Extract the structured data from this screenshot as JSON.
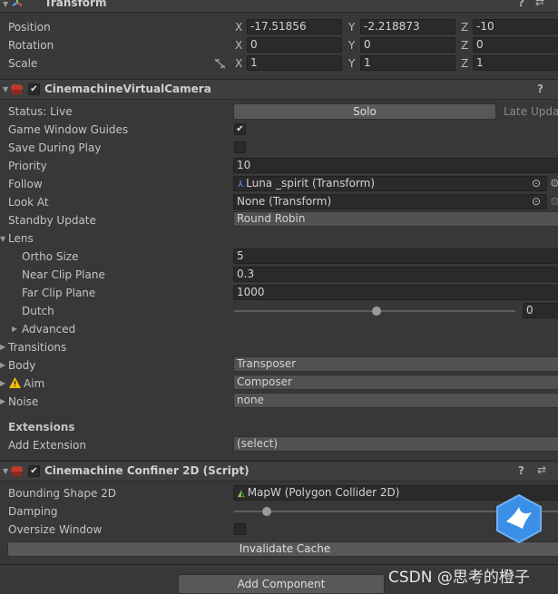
{
  "transform": {
    "title": "Transform",
    "position": {
      "label": "Position",
      "x": "-17.51856",
      "y": "-2.218873",
      "z": "-10"
    },
    "rotation": {
      "label": "Rotation",
      "x": "0",
      "y": "0",
      "z": "0"
    },
    "scale": {
      "label": "Scale",
      "x": "1",
      "y": "1",
      "z": "1"
    },
    "axis_x": "X",
    "axis_y": "Y",
    "axis_z": "Z"
  },
  "vcam": {
    "title": "CinemachineVirtualCamera",
    "status_label": "Status: Live",
    "solo_label": "Solo",
    "late_update": "Late Update",
    "game_window_guides": {
      "label": "Game Window Guides",
      "checked": true
    },
    "save_during_play": {
      "label": "Save During Play",
      "checked": false
    },
    "priority": {
      "label": "Priority",
      "value": "10"
    },
    "follow": {
      "label": "Follow",
      "value": "Luna _spirit (Transform)"
    },
    "look_at": {
      "label": "Look At",
      "value": "None (Transform)"
    },
    "standby_update": {
      "label": "Standby Update",
      "value": "Round Robin"
    },
    "lens": {
      "label": "Lens",
      "ortho_size": {
        "label": "Ortho Size",
        "value": "5"
      },
      "near_clip": {
        "label": "Near Clip Plane",
        "value": "0.3"
      },
      "far_clip": {
        "label": "Far Clip Plane",
        "value": "1000"
      },
      "dutch": {
        "label": "Dutch",
        "value": "0",
        "fraction": 0.5
      },
      "advanced": "Advanced"
    },
    "transitions": "Transitions",
    "body": {
      "label": "Body",
      "value": "Transposer"
    },
    "aim": {
      "label": "Aim",
      "value": "Composer"
    },
    "noise": {
      "label": "Noise",
      "value": "none"
    },
    "extensions_title": "Extensions",
    "add_extension": {
      "label": "Add Extension",
      "value": "(select)"
    }
  },
  "confiner": {
    "title": "Cinemachine Confiner 2D (Script)",
    "bounding_shape": {
      "label": "Bounding Shape 2D",
      "value": "MapW (Polygon Collider 2D)"
    },
    "damping": {
      "label": "Damping",
      "fraction": 0.1
    },
    "oversize_window": {
      "label": "Oversize Window",
      "checked": false
    },
    "invalidate_cache": "Invalidate Cache"
  },
  "add_component": "Add Component",
  "watermark": "CSDN @思考的橙子",
  "colors": {
    "warning": "#f2c100",
    "follow_icon": "#5aa0ff",
    "collider_icon": "#7bd44f",
    "badge": "#3b8fe6"
  }
}
